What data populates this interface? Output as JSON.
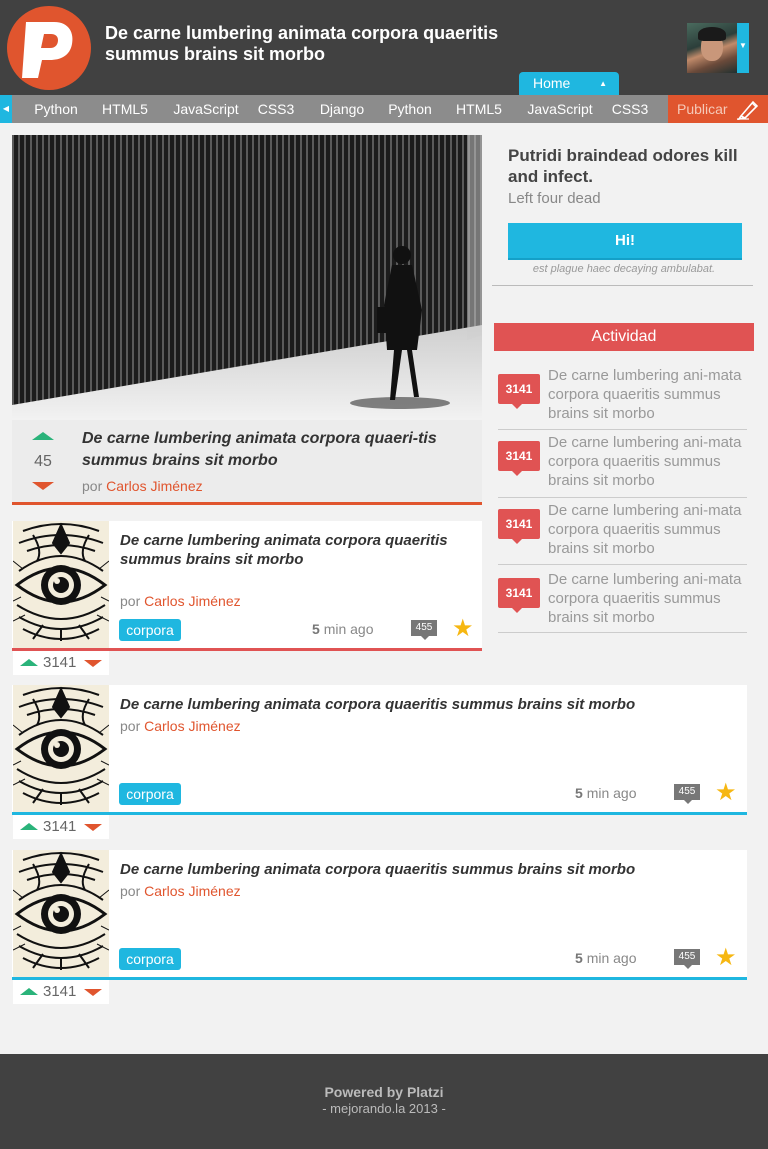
{
  "header": {
    "title": "De carne lumbering animata corpora quaeritis summus brains sit morbo",
    "home_tab": "Home"
  },
  "nav": {
    "items": [
      "Python",
      "HTML5",
      "JavaScript",
      "CSS3",
      "Django",
      "Python",
      "HTML5",
      "JavaScript",
      "CSS3"
    ],
    "publish": "Publicar"
  },
  "featured": {
    "title": "De carne lumbering animata corpora quaeri-tis summus brains sit morbo",
    "votes": "45",
    "by": "por",
    "author": "Carlos Jiménez"
  },
  "posts": [
    {
      "title": "De carne lumbering animata corpora quaeritis summus brains sit morbo",
      "by": "por",
      "author": "Carlos Jiménez",
      "tag": "corpora",
      "time_num": "5",
      "time_text": "min ago",
      "comments": "455",
      "votes": "3141",
      "accent": "#e05353"
    },
    {
      "title": "De carne lumbering animata corpora quaeritis summus brains sit morbo",
      "by": "por",
      "author": "Carlos Jiménez",
      "tag": "corpora",
      "time_num": "5",
      "time_text": "min ago",
      "comments": "455",
      "votes": "3141",
      "accent": "#1fb7e0"
    },
    {
      "title": "De carne lumbering animata corpora quaeritis summus brains sit morbo",
      "by": "por",
      "author": "Carlos Jiménez",
      "tag": "corpora",
      "time_num": "5",
      "time_text": "min ago",
      "comments": "455",
      "votes": "3141",
      "accent": "#1fb7e0"
    }
  ],
  "sidebar": {
    "promo_title": "Putridi braindead odores kill and infect.",
    "promo_sub": "Left four dead",
    "promo_button": "Hi!",
    "promo_note": "est plague haec decaying ambulabat.",
    "activity_title": "Actividad",
    "activity": [
      {
        "count": "3141",
        "text": "De carne lumbering ani-mata corpora quaeritis summus brains sit morbo"
      },
      {
        "count": "3141",
        "text": "De carne lumbering ani-mata corpora quaeritis summus brains sit morbo"
      },
      {
        "count": "3141",
        "text": "De carne lumbering ani-mata corpora quaeritis summus brains sit morbo"
      },
      {
        "count": "3141",
        "text": "De carne lumbering ani-mata corpora quaeritis summus brains sit morbo"
      }
    ]
  },
  "footer": {
    "powered": "Powered by Platzi",
    "credit": "- mejorando.la 2013 -"
  },
  "colors": {
    "orange": "#e0552e",
    "cyan": "#1fb7e0",
    "red": "#e05353",
    "green": "#2ab37a",
    "dark": "#414141"
  }
}
